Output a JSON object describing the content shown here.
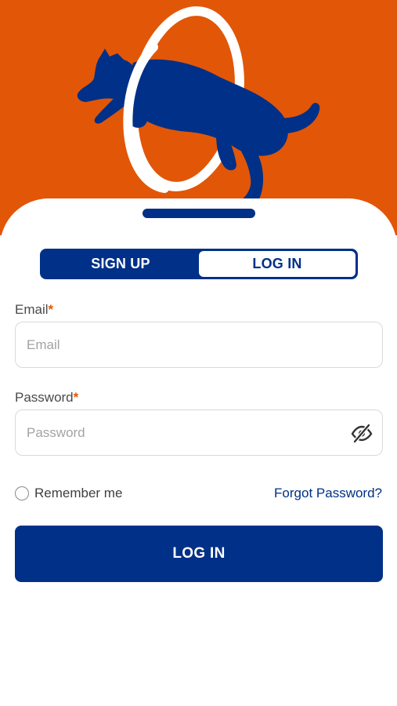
{
  "colors": {
    "brand_orange": "#e25608",
    "brand_blue": "#003087",
    "field_border": "#d9d9d9",
    "placeholder": "#a3a3a3"
  },
  "hero": {
    "illustration": "dog-jumping-through-hoop-icon"
  },
  "auth_toggle": {
    "signup_label": "SIGN UP",
    "login_label": "LOG IN",
    "active": "login"
  },
  "form": {
    "email": {
      "label": "Email",
      "required_mark": "*",
      "placeholder": "Email",
      "value": ""
    },
    "password": {
      "label": "Password",
      "required_mark": "*",
      "placeholder": "Password",
      "value": "",
      "visibility_icon": "eye-slash-icon"
    },
    "remember_me": {
      "label": "Remember me",
      "checked": false
    },
    "forgot_password_label": "Forgot Password?",
    "submit_label": "LOG IN"
  }
}
